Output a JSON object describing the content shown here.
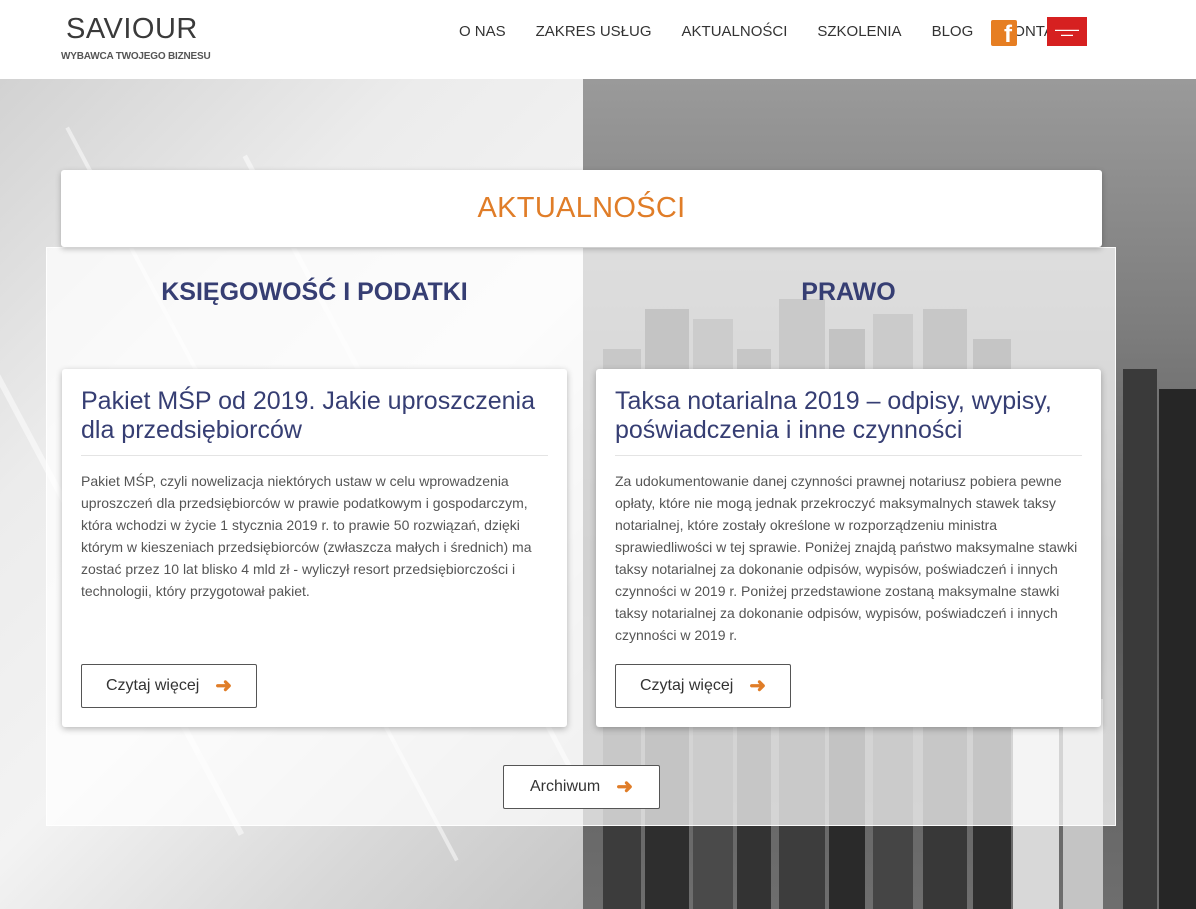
{
  "header": {
    "logo_title": "SAVIOUR",
    "logo_tagline": "WYBAWCA TWOJEGO BIZNESU",
    "nav": [
      "O NAS",
      "ZAKRES USŁUG",
      "AKTUALNOŚCI",
      "SZKOLENIA",
      "BLOG",
      "KONTAKT"
    ],
    "facebook_icon": "facebook-icon",
    "badge_icon": "red-badge-icon"
  },
  "page": {
    "title": "AKTUALNOŚCI",
    "archive_label": "Archiwum",
    "accent_color": "#e07d28",
    "heading_color": "#363e73"
  },
  "columns": [
    {
      "title": "KSIĘGOWOŚĆ I PODATKI",
      "article": {
        "title": "Pakiet MŚP od 2019. Jakie uproszczenia dla przedsiębiorców",
        "excerpt": "Pakiet MŚP, czyli nowelizacja niektórych ustaw w celu wprowadzenia uproszczeń dla przedsiębiorców w prawie podatkowym i gospodarczym, która wchodzi w życie 1 stycznia 2019 r. to prawie 50 rozwiązań, dzięki którym w kieszeniach przedsiębiorców (zwłaszcza małych i średnich) ma zostać przez 10 lat blisko 4 mld zł - wyliczył resort przedsiębiorczości i technologii, który przygotował pakiet.",
        "button": "Czytaj więcej"
      }
    },
    {
      "title": "PRAWO",
      "article": {
        "title": "Taksa notarialna 2019 – odpisy, wypisy, poświadczenia i inne czynności",
        "excerpt": "Za udokumentowanie danej czynności prawnej notariusz pobiera pewne opłaty, które nie mogą jednak przekroczyć maksymalnych stawek taksy notarialnej, które zostały określone w rozporządzeniu ministra sprawiedliwości w tej sprawie. Poniżej znajdą państwo maksymalne stawki taksy notarialnej za dokonanie odpisów, wypisów, poświadczeń i innych czynności w 2019 r. Poniżej przedstawione zostaną maksymalne stawki taksy notarialnej za dokonanie odpisów, wypisów, poświadczeń i innych czynności w 2019 r.",
        "button": "Czytaj więcej"
      }
    }
  ]
}
